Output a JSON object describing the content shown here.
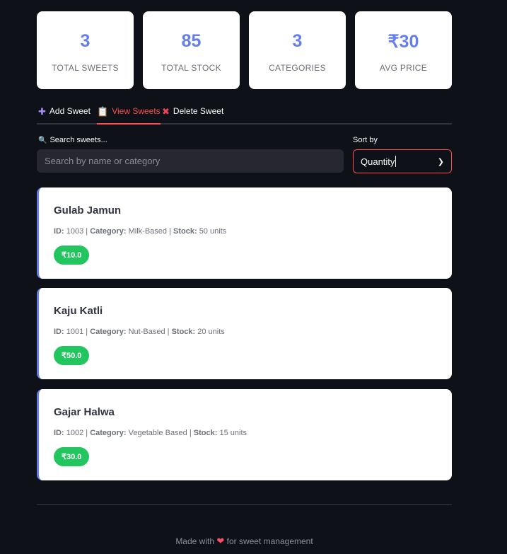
{
  "metrics": [
    {
      "value": "3",
      "label": "TOTAL SWEETS"
    },
    {
      "value": "85",
      "label": "TOTAL STOCK"
    },
    {
      "value": "3",
      "label": "CATEGORIES"
    },
    {
      "value": "₹30",
      "label": "AVG PRICE"
    }
  ],
  "tabs": [
    {
      "icon": "plus-icon",
      "glyph": "✚",
      "label": "Add Sweet",
      "color": "#a78bfa"
    },
    {
      "icon": "clipboard-icon",
      "glyph": "📋",
      "label": "View Sweets"
    },
    {
      "icon": "cross-icon",
      "glyph": "✖",
      "label": "Delete Sweet",
      "color": "#f43f5e"
    }
  ],
  "search": {
    "label_icon": "magnifier-icon",
    "label": "Search sweets...",
    "placeholder": "Search by name or category",
    "value": ""
  },
  "sort": {
    "label": "Sort by",
    "value": "Quantity"
  },
  "sweets": [
    {
      "name": "Gulab Jamun",
      "id_label": "ID:",
      "id": "1003",
      "category_label": "Category:",
      "category": "Milk-Based",
      "stock_label": "Stock:",
      "stock": "50 units",
      "price": "₹10.0"
    },
    {
      "name": "Kaju Katli",
      "id_label": "ID:",
      "id": "1001",
      "category_label": "Category:",
      "category": "Nut-Based",
      "stock_label": "Stock:",
      "stock": "20 units",
      "price": "₹50.0"
    },
    {
      "name": "Gajar Halwa",
      "id_label": "ID:",
      "id": "1002",
      "category_label": "Category:",
      "category": "Vegetable Based",
      "stock_label": "Stock:",
      "stock": "15 units",
      "price": "₹30.0"
    }
  ],
  "footer": {
    "prefix": "Made with",
    "heart": "❤",
    "suffix": "for sweet management"
  },
  "colors": {
    "accent": "#667eea",
    "active_tab": "#ff4b4b",
    "price_badge": "#22c55e",
    "background": "#0e1117"
  }
}
